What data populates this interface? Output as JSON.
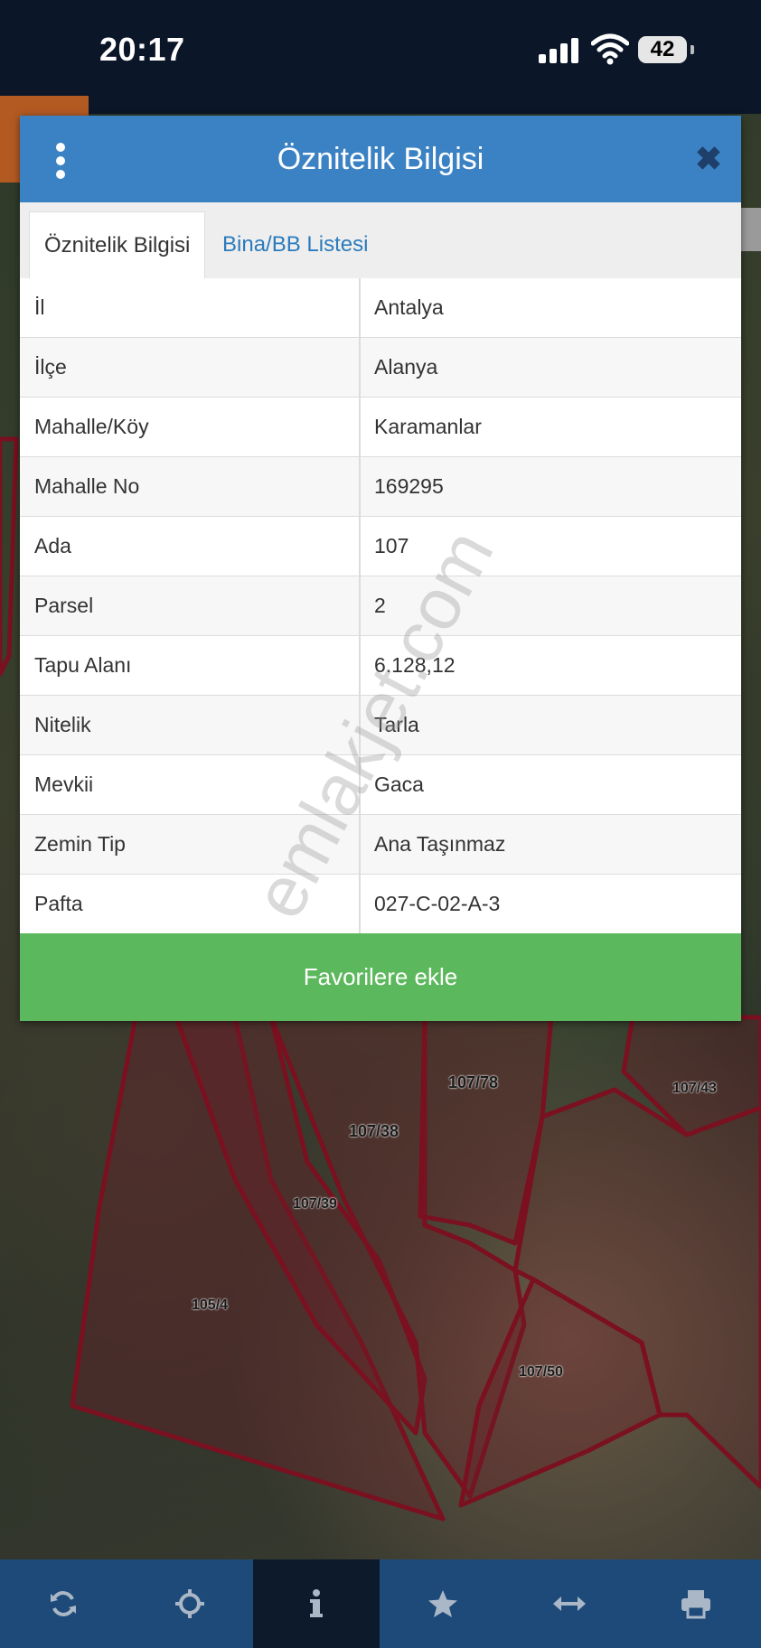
{
  "status_bar": {
    "time": "20:17",
    "battery": "42"
  },
  "modal": {
    "title": "Öznitelik Bilgisi",
    "tabs": [
      {
        "label": "Öznitelik Bilgisi",
        "active": true
      },
      {
        "label": "Bina/BB Listesi",
        "active": false
      }
    ],
    "rows": [
      {
        "key": "İl",
        "value": "Antalya"
      },
      {
        "key": "İlçe",
        "value": "Alanya"
      },
      {
        "key": "Mahalle/Köy",
        "value": "Karamanlar"
      },
      {
        "key": "Mahalle No",
        "value": "169295"
      },
      {
        "key": "Ada",
        "value": "107"
      },
      {
        "key": "Parsel",
        "value": "2"
      },
      {
        "key": "Tapu Alanı",
        "value": "6.128,12"
      },
      {
        "key": "Nitelik",
        "value": "Tarla"
      },
      {
        "key": "Mevkii",
        "value": "Gaca"
      },
      {
        "key": "Zemin Tip",
        "value": "Ana Taşınmaz"
      },
      {
        "key": "Pafta",
        "value": "027-C-02-A-3"
      }
    ],
    "favorite_button": "Favorilere ekle",
    "watermark": "emlakjet.com"
  },
  "map": {
    "parcel_labels": [
      "107/78",
      "107/43",
      "107/38",
      "107/39",
      "105/4",
      "107/50"
    ]
  },
  "toolbar": {
    "items": [
      {
        "icon": "refresh-icon",
        "active": false
      },
      {
        "icon": "locate-icon",
        "active": false
      },
      {
        "icon": "info-icon",
        "active": true
      },
      {
        "icon": "star-icon",
        "active": false
      },
      {
        "icon": "measure-icon",
        "active": false
      },
      {
        "icon": "print-icon",
        "active": false
      }
    ]
  },
  "colors": {
    "header": "#3b82c4",
    "favorite": "#5cb85c",
    "toolbar": "#1e4a7a",
    "parcel_border": "#7a1020"
  }
}
